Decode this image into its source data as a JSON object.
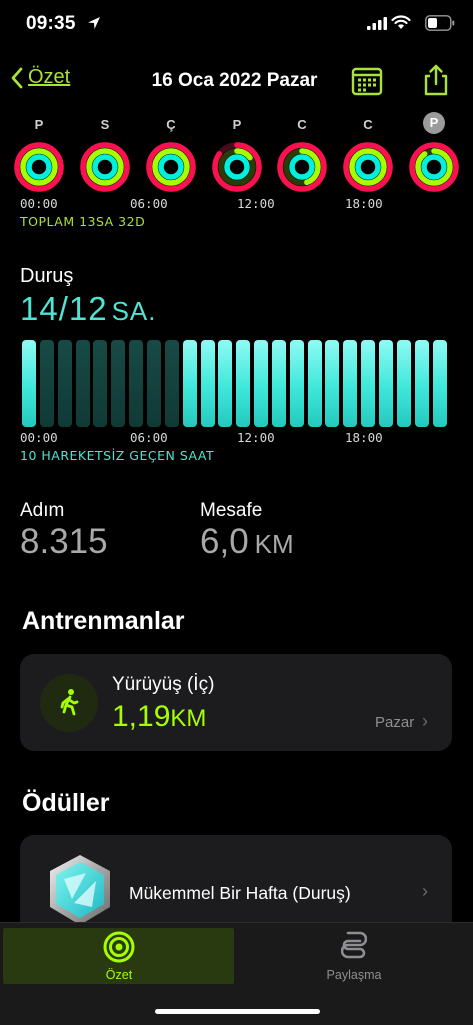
{
  "status_bar": {
    "time": "09:35"
  },
  "nav": {
    "back_label": "Özet",
    "title": "16 Oca 2022 Pazar"
  },
  "week": [
    {
      "letter": "P",
      "move": 1.0,
      "exercise": 1.0,
      "stand": 1.0
    },
    {
      "letter": "S",
      "move": 1.0,
      "exercise": 1.0,
      "stand": 1.0
    },
    {
      "letter": "Ç",
      "move": 1.0,
      "exercise": 1.0,
      "stand": 1.0
    },
    {
      "letter": "P",
      "move": 0.85,
      "exercise": 0.15,
      "stand": 1.0
    },
    {
      "letter": "C",
      "move": 1.0,
      "exercise": 0.45,
      "stand": 1.0
    },
    {
      "letter": "C",
      "move": 1.0,
      "exercise": 1.0,
      "stand": 1.0
    },
    {
      "letter": "P",
      "move": 1.0,
      "exercise": 0.9,
      "stand": 1.0,
      "selected": true
    }
  ],
  "exercise_chart": {
    "ticks": [
      "00:00",
      "06:00",
      "12:00",
      "18:00"
    ],
    "caption": "TOPLAM 13SA 32D"
  },
  "stand": {
    "label": "Duruş",
    "value": "14/12",
    "unit": "SA.",
    "ticks": [
      "00:00",
      "06:00",
      "12:00",
      "18:00"
    ],
    "caption": "10 HAREKETSİZ GEÇEN SAAT"
  },
  "chart_data": {
    "type": "bar",
    "categories": [
      "00",
      "01",
      "02",
      "03",
      "04",
      "05",
      "06",
      "07",
      "08",
      "09",
      "10",
      "11",
      "12",
      "13",
      "14",
      "15",
      "16",
      "17",
      "18",
      "19",
      "20",
      "21",
      "22",
      "23"
    ],
    "values": [
      1,
      0,
      0,
      0,
      0,
      0,
      0,
      0,
      0,
      1,
      1,
      1,
      1,
      1,
      1,
      1,
      1,
      1,
      1,
      1,
      1,
      1,
      1,
      1
    ],
    "ylim": [
      0,
      1
    ]
  },
  "metrics": {
    "steps_label": "Adım",
    "steps_value": "8.315",
    "distance_label": "Mesafe",
    "distance_value": "6,0",
    "distance_unit": "KM"
  },
  "workouts": {
    "heading": "Antrenmanlar",
    "item_title": "Yürüyüş (İç)",
    "item_value": "1,19",
    "item_unit": "KM",
    "item_day": "Pazar"
  },
  "awards": {
    "heading": "Ödüller",
    "item_title": "Mükemmel Bir Hafta (Duruş)"
  },
  "tabbar": {
    "summary_label": "Özet",
    "sharing_label": "Paylaşma"
  },
  "colors": {
    "move": "#fa114f",
    "exercise": "#a6ff00",
    "stand": "#00f0e0",
    "accent": "#a8e23a"
  }
}
